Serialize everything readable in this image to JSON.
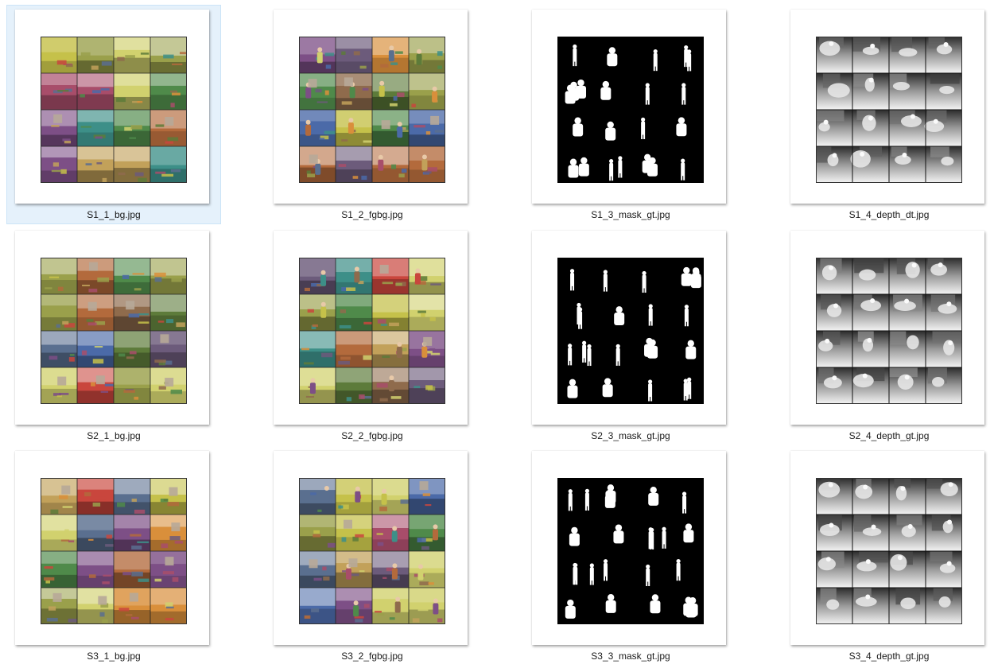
{
  "window": {
    "view": "Large icons",
    "selected_file": "S1_1_bg.jpg"
  },
  "files": [
    {
      "name": "S1_1_bg.jpg",
      "kind": "bg",
      "selected": true
    },
    {
      "name": "S1_2_fgbg.jpg",
      "kind": "fgbg",
      "selected": false
    },
    {
      "name": "S1_3_mask_gt.jpg",
      "kind": "mask",
      "selected": false
    },
    {
      "name": "S1_4_depth_dt.jpg",
      "kind": "depth",
      "selected": false
    },
    {
      "name": "S2_1_bg.jpg",
      "kind": "bg",
      "selected": false
    },
    {
      "name": "S2_2_fgbg.jpg",
      "kind": "fgbg",
      "selected": false
    },
    {
      "name": "S2_3_mask_gt.jpg",
      "kind": "mask",
      "selected": false
    },
    {
      "name": "S2_4_depth_gt.jpg",
      "kind": "depth",
      "selected": false
    },
    {
      "name": "S3_1_bg.jpg",
      "kind": "bg",
      "selected": false
    },
    {
      "name": "S3_2_fgbg.jpg",
      "kind": "fgbg",
      "selected": false
    },
    {
      "name": "S3_3_mask_gt.jpg",
      "kind": "mask",
      "selected": false
    },
    {
      "name": "S3_4_depth_gt.jpg",
      "kind": "depth",
      "selected": false
    }
  ],
  "colors": {
    "selection_bg": "#e5f1fb",
    "selection_border": "#cce4f7",
    "label_text": "#1a1a1a",
    "mask_bg": "#000000",
    "mask_fg": "#ffffff"
  }
}
